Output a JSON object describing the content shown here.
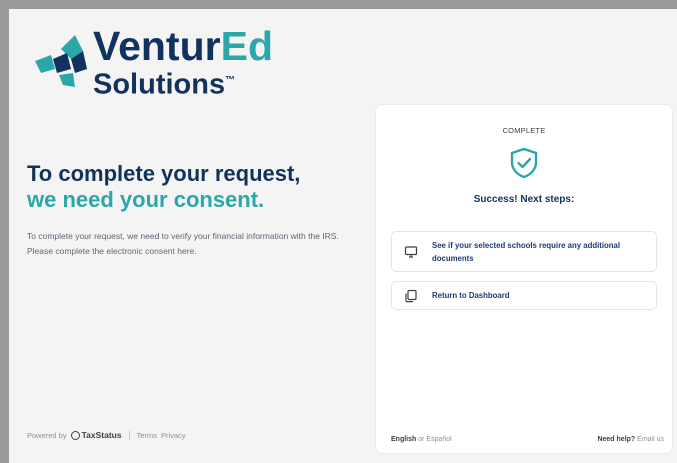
{
  "brand": {
    "name_part1": "Ventur",
    "name_part2": "Ed",
    "name_line2": "Solutions",
    "trademark": "™",
    "colors": {
      "navy": "#12325e",
      "teal": "#2aa7a9"
    }
  },
  "left": {
    "headline_line1": "To complete your request,",
    "headline_line2": "we need your consent.",
    "intro": "To complete your request, we need to verify your financial information with the IRS. Please complete the electronic consent here."
  },
  "footer": {
    "powered_by": "Powered by",
    "provider": "TaxStatus",
    "terms": "Terms",
    "privacy": "Privacy"
  },
  "card": {
    "status": "COMPLETE",
    "title": "Success! Next steps:",
    "actions": [
      {
        "label": "See if your selected schools require any additional documents",
        "icon": "monitor-icon"
      },
      {
        "label": "Return to Dashboard",
        "icon": "copy-icon"
      }
    ],
    "lang_english": "English",
    "lang_or": "or",
    "lang_spanish": "Español",
    "help_label": "Need help?",
    "email_label": "Email us"
  }
}
